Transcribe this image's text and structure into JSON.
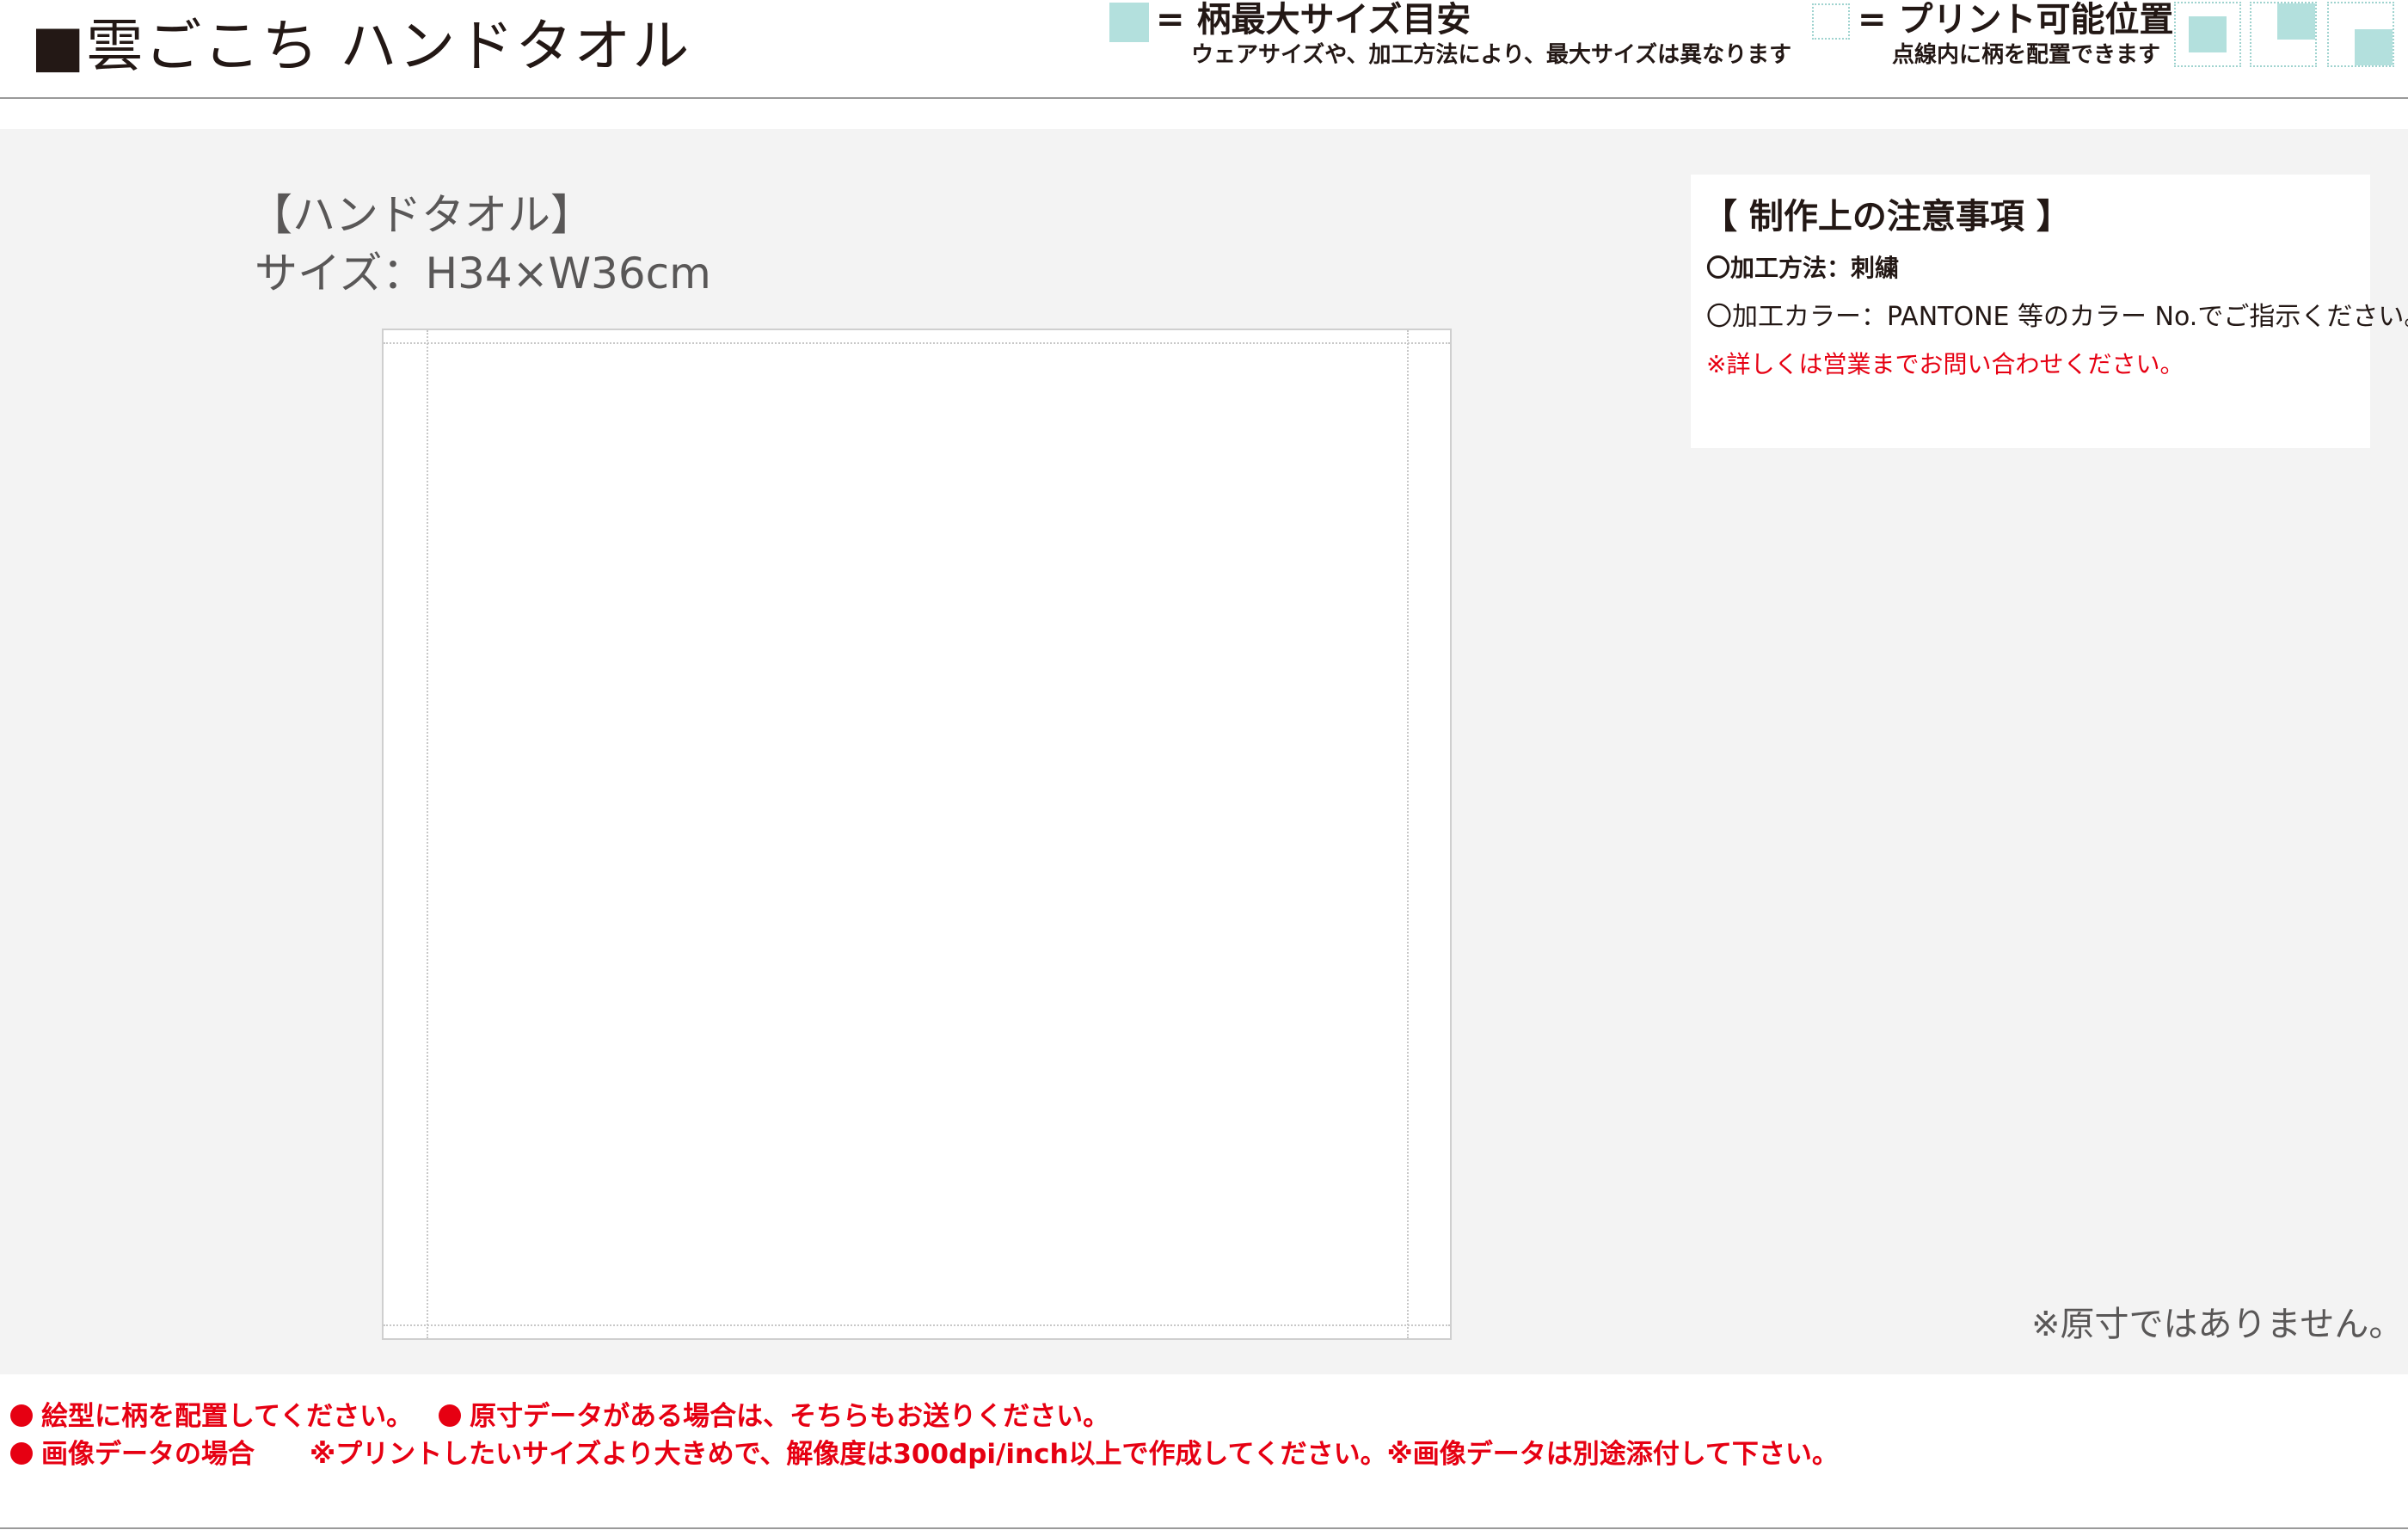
{
  "header": {
    "title": "■雲ごこち ハンドタオル",
    "legend_max": {
      "label": "= 柄最大サイズ目安",
      "note": "ウェアサイズや、加工方法により、最大サイズは異なります",
      "color": "#b3e0dd"
    },
    "legend_print": {
      "label": "= プリント可能位置",
      "note": "点線内に柄を配置できます"
    }
  },
  "product": {
    "heading": "【ハンドタオル】",
    "size": "サイズ：H34×W36cm"
  },
  "notes": {
    "title": "【 制作上の注意事項 】",
    "method": "〇加工方法：刺繍",
    "color": "〇加工カラー：PANTONE 等のカラー No.でご指示ください。",
    "contact": "※詳しくは営業までお問い合わせください。"
  },
  "not_actual_size": "※原寸ではありません。",
  "footer": {
    "line1_a": "絵型に柄を配置してください。",
    "line1_b": "原寸データがある場合は、そちらもお送りください。",
    "line2_a": "画像データの場合",
    "line2_b": "※プリントしたいサイズより大きめで、解像度は300dpi/inch以上で作成してください。※画像データは別途添付して下さい。"
  },
  "colors": {
    "accent_red": "#e60012",
    "swatch": "#b3e0dd",
    "background_gray": "#f3f3f3"
  }
}
